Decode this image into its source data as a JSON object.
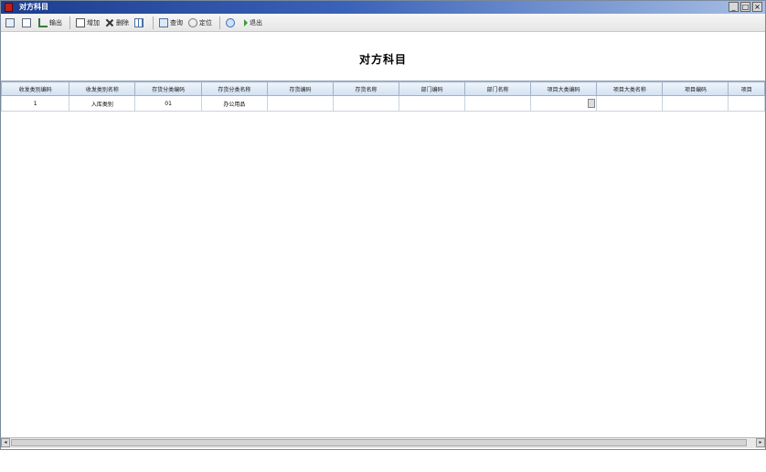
{
  "window": {
    "title": "对方科目",
    "controls": [
      "_",
      "□",
      "×"
    ]
  },
  "toolbar": {
    "buttons": [
      {
        "name": "print",
        "label": ""
      },
      {
        "name": "preview",
        "label": ""
      },
      {
        "name": "export",
        "label": "输出"
      },
      {
        "name": "add",
        "label": "增加"
      },
      {
        "name": "delete",
        "label": "删除"
      },
      {
        "name": "grid",
        "label": ""
      },
      {
        "name": "query",
        "label": "查询"
      },
      {
        "name": "locate",
        "label": "定位"
      },
      {
        "name": "help",
        "label": ""
      },
      {
        "name": "exit",
        "label": "退出"
      }
    ]
  },
  "page": {
    "title": "对方科目"
  },
  "grid": {
    "columns": [
      "收发类别编码",
      "收发类别名称",
      "存货分类编码",
      "存货分类名称",
      "存货编码",
      "存货名称",
      "部门编码",
      "部门名称",
      "项目大类编码",
      "项目大类名称",
      "项目编码",
      "项目"
    ],
    "rows": [
      [
        "1",
        "入库类别",
        "01",
        "办公用品",
        "",
        "",
        "",
        "",
        "",
        "",
        "",
        ""
      ]
    ]
  },
  "scrollbar": {
    "left_arrow": "◂",
    "right_arrow": "▸"
  }
}
